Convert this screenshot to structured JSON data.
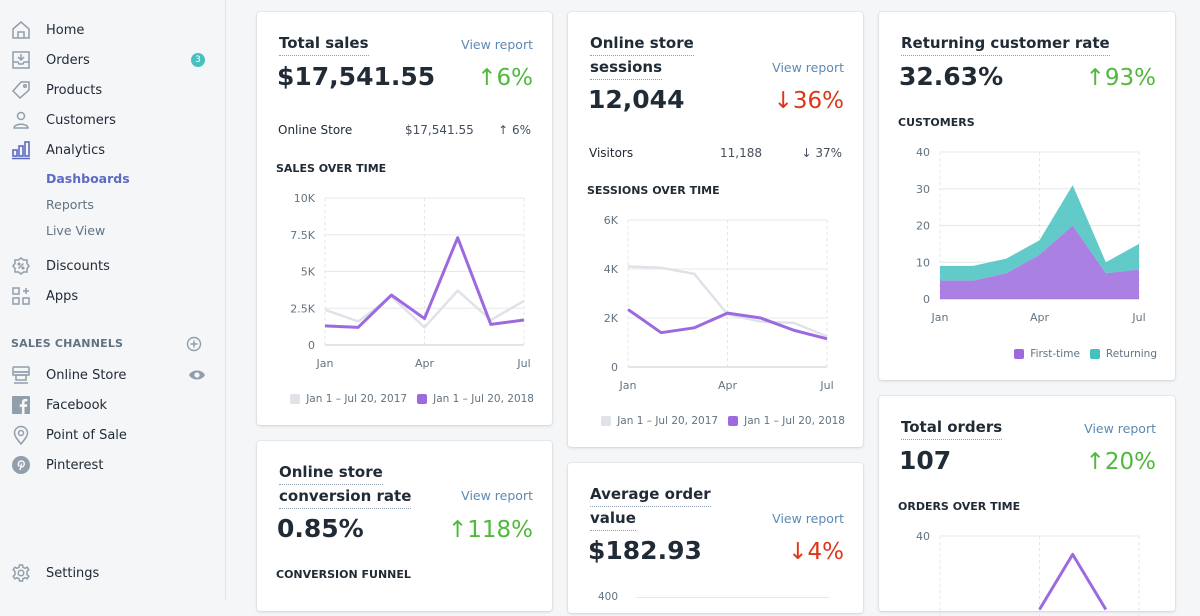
{
  "sidebar": {
    "items": [
      {
        "label": "Home",
        "icon": "home-icon"
      },
      {
        "label": "Orders",
        "icon": "orders-icon",
        "badge": "3"
      },
      {
        "label": "Products",
        "icon": "tag-icon"
      },
      {
        "label": "Customers",
        "icon": "person-icon"
      },
      {
        "label": "Analytics",
        "icon": "bar-chart-icon"
      }
    ],
    "analytics_sub": [
      {
        "label": "Dashboards",
        "active": true
      },
      {
        "label": "Reports"
      },
      {
        "label": "Live View"
      }
    ],
    "items2": [
      {
        "label": "Discounts",
        "icon": "discount-icon"
      },
      {
        "label": "Apps",
        "icon": "apps-icon"
      }
    ],
    "sales_channels_heading": "SALES CHANNELS",
    "channels": [
      {
        "label": "Online Store",
        "icon": "store-icon"
      },
      {
        "label": "Facebook",
        "icon": "facebook-icon"
      },
      {
        "label": "Point of Sale",
        "icon": "location-pin-icon"
      },
      {
        "label": "Pinterest",
        "icon": "pinterest-icon"
      }
    ],
    "settings": {
      "label": "Settings",
      "icon": "gear-icon"
    }
  },
  "colors": {
    "accent": "#5c6ac4",
    "up": "#50b83c",
    "down": "#de3618",
    "purple_series": "#9c6ade",
    "grey_series": "#dfe3e8",
    "teal": "#47c1bf",
    "link": "#5b8ab4"
  },
  "cards": {
    "total_sales": {
      "title": "Total sales",
      "view_report": "View report",
      "value": "$17,541.55",
      "delta": "↑6%",
      "row": {
        "label": "Online Store",
        "value": "$17,541.55",
        "delta": "↑ 6%"
      },
      "chart_title": "SALES OVER TIME",
      "legend": [
        "Jan 1 – Jul 20, 2017",
        "Jan 1 – Jul 20, 2018"
      ]
    },
    "sessions": {
      "title_line1": "Online store",
      "title_line2": "sessions",
      "view_report": "View report",
      "value": "12,044",
      "delta": "↓36%",
      "row": {
        "label": "Visitors",
        "value": "11,188",
        "delta": "↓ 37%"
      },
      "chart_title": "SESSIONS OVER TIME",
      "legend": [
        "Jan 1 – Jul 20, 2017",
        "Jan 1 – Jul 20, 2018"
      ]
    },
    "returning": {
      "title": "Returning customer rate",
      "value": "32.63%",
      "delta": "↑93%",
      "chart_title": "CUSTOMERS",
      "legend": [
        "First-time",
        "Returning"
      ]
    },
    "conversion": {
      "title_line1": "Online store",
      "title_line2": "conversion rate",
      "view_report": "View report",
      "value": "0.85%",
      "delta": "↑118%",
      "chart_title": "CONVERSION FUNNEL"
    },
    "aov": {
      "title_line1": "Average order",
      "title_line2": "value",
      "view_report": "View report",
      "value": "$182.93",
      "delta": "↓4%",
      "axis_top": "400"
    },
    "orders": {
      "title": "Total orders",
      "view_report": "View report",
      "value": "107",
      "delta": "↑20%",
      "chart_title": "ORDERS OVER TIME",
      "axis_top": "40"
    }
  },
  "chart_data": [
    {
      "id": "sales",
      "type": "line",
      "title": "SALES OVER TIME",
      "x_ticks": [
        "Jan",
        "Apr",
        "Jul"
      ],
      "y_ticks": [
        "0",
        "2.5K",
        "5K",
        "7.5K",
        "10K"
      ],
      "ylim": [
        0,
        10000
      ],
      "x": [
        0,
        1,
        2,
        3,
        4,
        5,
        6
      ],
      "series": [
        {
          "name": "Jan 1 – Jul 20, 2017",
          "values": [
            2400,
            1600,
            3300,
            1200,
            3700,
            1700,
            3000
          ]
        },
        {
          "name": "Jan 1 – Jul 20, 2018",
          "values": [
            1300,
            1200,
            3400,
            1800,
            7300,
            1400,
            1700
          ]
        }
      ]
    },
    {
      "id": "sessions",
      "type": "line",
      "title": "SESSIONS OVER TIME",
      "x_ticks": [
        "Jan",
        "Apr",
        "Jul"
      ],
      "y_ticks": [
        "0",
        "2K",
        "4K",
        "6K"
      ],
      "ylim": [
        0,
        6000
      ],
      "x": [
        0,
        1,
        2,
        3,
        4,
        5,
        6
      ],
      "series": [
        {
          "name": "Jan 1 – Jul 20, 2017",
          "values": [
            4100,
            4050,
            3800,
            2150,
            1850,
            1800,
            1250
          ]
        },
        {
          "name": "Jan 1 – Jul 20, 2018",
          "values": [
            2350,
            1400,
            1600,
            2200,
            2000,
            1500,
            1150
          ]
        }
      ]
    },
    {
      "id": "customers",
      "type": "area",
      "title": "CUSTOMERS",
      "x_ticks": [
        "Jan",
        "Apr",
        "Jul"
      ],
      "y_ticks": [
        "0",
        "10",
        "20",
        "30",
        "40"
      ],
      "ylim": [
        0,
        40
      ],
      "x": [
        0,
        1,
        2,
        3,
        4,
        5,
        6
      ],
      "stacked": true,
      "series": [
        {
          "name": "First-time",
          "values": [
            5,
            5,
            7,
            12,
            20,
            7,
            8
          ]
        },
        {
          "name": "Returning",
          "values": [
            4,
            4,
            4,
            4,
            11,
            3,
            7
          ]
        }
      ]
    },
    {
      "id": "orders",
      "type": "line",
      "title": "ORDERS OVER TIME",
      "y_ticks": [
        "40"
      ],
      "ylim": [
        0,
        40
      ],
      "x": [
        3,
        4,
        5
      ],
      "series": [
        {
          "name": "Jan 1 – Jul 20, 2018",
          "values": [
            20,
            35,
            20
          ]
        }
      ]
    }
  ]
}
